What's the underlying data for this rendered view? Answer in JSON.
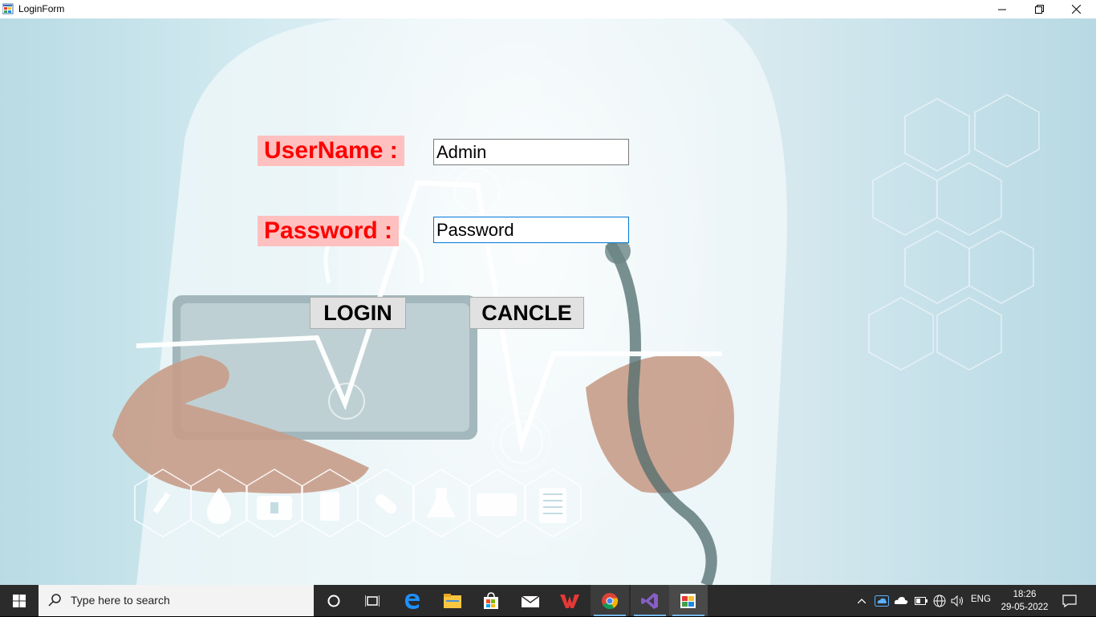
{
  "window": {
    "title": "LoginForm"
  },
  "form": {
    "username_label": "UserName :",
    "password_label": "Password :",
    "username_value": "Admin",
    "password_value": "Password",
    "login_button": "LOGIN",
    "cancel_button": "CANCLE"
  },
  "colors": {
    "label_text": "#ff0000",
    "label_bg": "#ffc0c0",
    "button_bg": "#e1e1e1",
    "taskbar_bg": "#2b2b2b"
  },
  "taskbar": {
    "search_placeholder": "Type here to search",
    "apps": [
      "task-view-icon",
      "edge-icon",
      "file-explorer-icon",
      "store-icon",
      "mail-icon",
      "wps-office-icon",
      "chrome-icon",
      "visual-studio-icon",
      "loginform-app-icon"
    ],
    "language": "ENG",
    "time": "18:26",
    "date": "29-05-2022"
  }
}
